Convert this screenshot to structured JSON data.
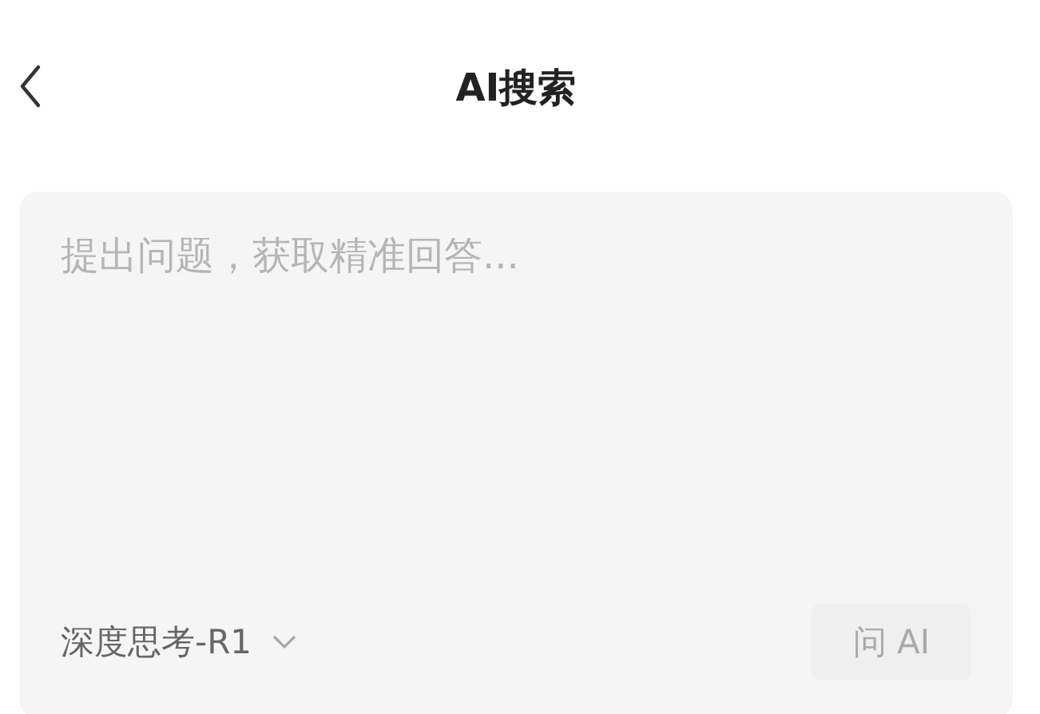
{
  "header": {
    "title": "AI搜索"
  },
  "query": {
    "placeholder": "提出问题，获取精准回答..."
  },
  "model_selector": {
    "label": "深度思考-R1"
  },
  "ask_button": {
    "label": "问 AI",
    "disabled": true
  }
}
